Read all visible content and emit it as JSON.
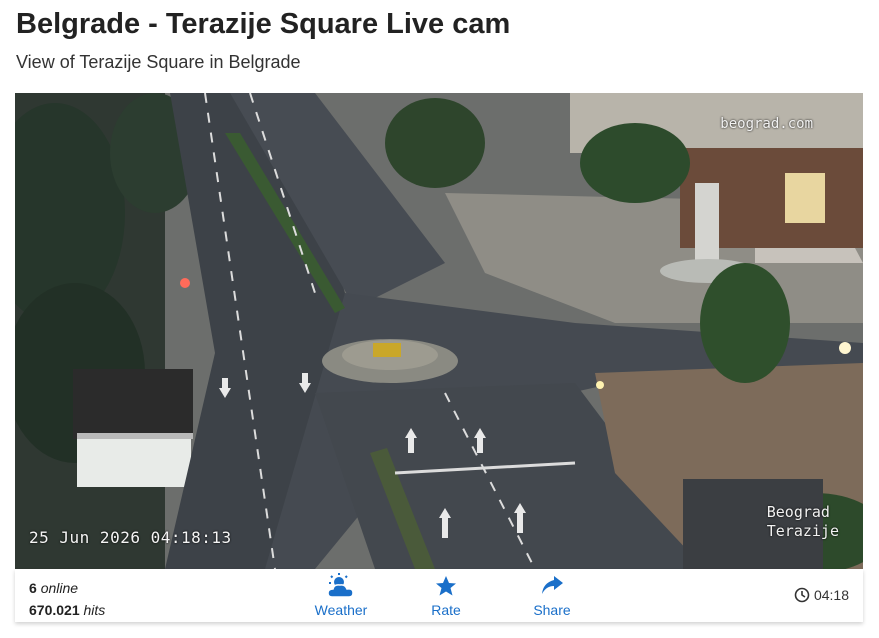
{
  "page": {
    "title": "Belgrade - Terazije Square Live cam",
    "subtitle": "View of Terazije Square in Belgrade"
  },
  "camera": {
    "watermark_top": "beograd.com",
    "watermark_bottom": "Beograd\nTerazije",
    "timestamp": "25 Jun 2026 04:18:13"
  },
  "bar": {
    "online_count": "6",
    "online_label": "online",
    "hits_count": "670.021",
    "hits_label": "hits",
    "weather_label": "Weather",
    "rate_label": "Rate",
    "share_label": "Share",
    "time": "04:18"
  },
  "colors": {
    "accent": "#1a6fc9"
  },
  "icons": {
    "weather": "partly-cloudy-icon",
    "rate": "star-icon",
    "share": "share-arrow-icon",
    "clock": "clock-icon"
  }
}
